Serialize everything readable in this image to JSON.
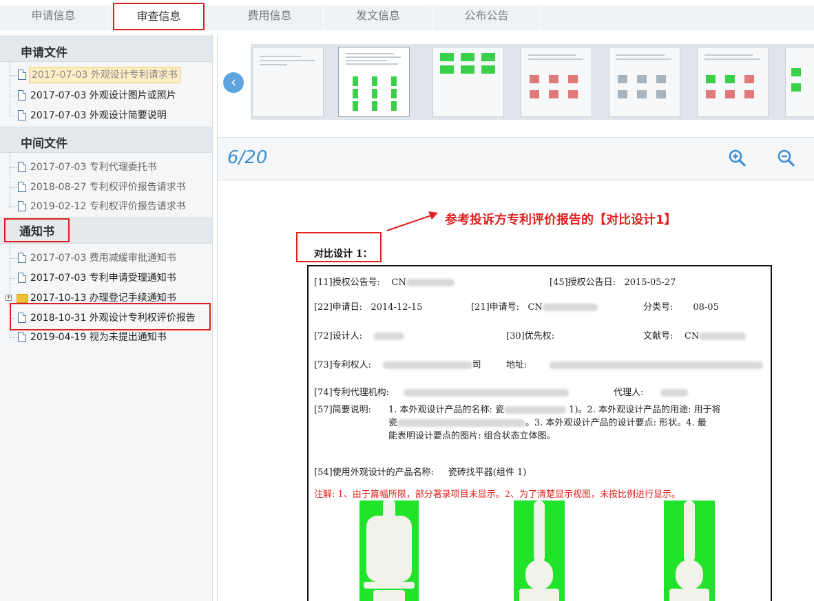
{
  "tabs": [
    {
      "label": "申请信息",
      "active": false
    },
    {
      "label": "审查信息",
      "active": true
    },
    {
      "label": "费用信息",
      "active": false
    },
    {
      "label": "发文信息",
      "active": false
    },
    {
      "label": "公布公告",
      "active": false
    }
  ],
  "sidebar": {
    "sections": [
      {
        "title": "申请文件",
        "items": [
          {
            "label": "2017-07-03 外观设计专利请求书",
            "state": "selected"
          },
          {
            "label": "2017-07-03 外观设计图片或照片",
            "state": "normal"
          },
          {
            "label": "2017-07-03 外观设计简要说明",
            "state": "normal"
          }
        ]
      },
      {
        "title": "中间文件",
        "items": [
          {
            "label": "2017-07-03 专利代理委托书",
            "state": "grey"
          },
          {
            "label": "2018-08-27 专利权评价报告请求书",
            "state": "grey"
          },
          {
            "label": "2019-02-12 专利权评价报告请求书",
            "state": "grey"
          }
        ]
      },
      {
        "title": "通知书",
        "items": [
          {
            "label": "2017-07-03 费用减缓审批通知书",
            "state": "grey"
          },
          {
            "label": "2017-07-03 专利申请受理通知书",
            "state": "normal"
          },
          {
            "label": "2017-10-13 办理登记手续通知书",
            "state": "folder"
          },
          {
            "label": "2018-10-31 外观设计专利权评价报告",
            "state": "normal"
          },
          {
            "label": "2019-04-19 视为未提出通知书",
            "state": "normal"
          }
        ]
      }
    ]
  },
  "viewer": {
    "page_indicator": "6/20",
    "zoom_in_icon": "zoom-in-icon",
    "zoom_out_icon": "zoom-out-icon",
    "annotation": "参考投诉方专利评价报告的【对比设计1】",
    "duibi_label": "对比设计 1："
  },
  "document": {
    "f11": "[11]授权公告号:",
    "f11_val": "CN",
    "f45": "[45]授权公告日:",
    "f45_val": "2015-05-27",
    "f22": "[22]申请日:",
    "f22_val": "2014-12-15",
    "f21": "[21]申请号:",
    "f21_val": "CN",
    "fcls": "分类号:",
    "fcls_val": "08-05",
    "f72": "[72]设计人:",
    "f30": "[30]优先权:",
    "fdoc": "文献号:",
    "fdoc_val": "CN",
    "f73": "[73]专利权人:",
    "f73_tail": "司",
    "faddr": "地址:",
    "f74": "[74]专利代理机构:",
    "fagent": "代理人:",
    "f57": "[57]简要说明:",
    "f57_l1a": "1. 本外观设计产品的名称: 瓷",
    "f57_l1b": "1)。2. 本外观设计产品的用途: 用于将",
    "f57_l2a": "瓷",
    "f57_l2b": "。3. 本外观设计产品的设计要点: 形状。4. 最",
    "f57_l3": "能表明设计要点的图片: 组合状态立体图。",
    "f54": "[54]使用外观设计的产品名称:",
    "f54_val": "瓷砖找平器(组件 1)",
    "note": "注解: 1、由于篇幅所限，部分著录项目未显示。2、为了清楚显示视图，未按比例进行显示。"
  },
  "colors": {
    "accent_red": "#e0201e",
    "accent_blue": "#3d8ed6",
    "photo_bg": "#21e32a"
  }
}
